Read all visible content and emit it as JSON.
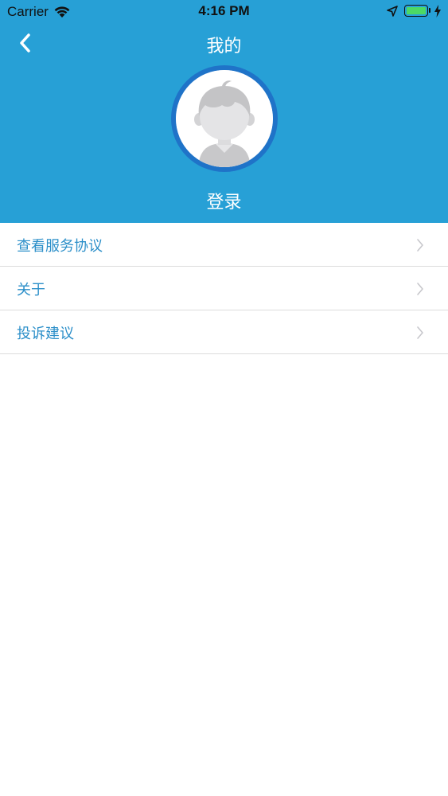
{
  "status_bar": {
    "carrier": "Carrier",
    "time": "4:16 PM",
    "battery_color": "#4cd964"
  },
  "nav": {
    "title": "我的",
    "back_icon": "chevron-left-icon"
  },
  "profile": {
    "avatar_icon": "default-boy-avatar-icon",
    "login_label": "登录"
  },
  "menu": {
    "items": [
      {
        "label": "查看服务协议",
        "icon": "chevron-right-icon"
      },
      {
        "label": "关于",
        "icon": "chevron-right-icon"
      },
      {
        "label": "投诉建议",
        "icon": "chevron-right-icon"
      }
    ]
  },
  "colors": {
    "header_bg": "#27a0d6",
    "avatar_ring": "#1f73c8",
    "menu_text": "#2c8fc9"
  }
}
